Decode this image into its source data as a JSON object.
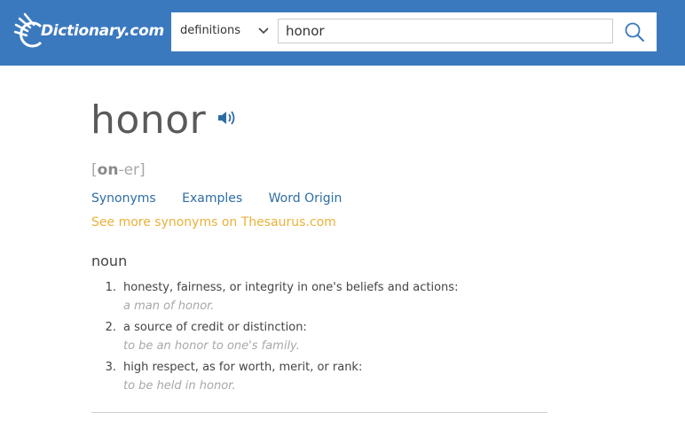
{
  "header": {
    "logo_text": "Dictionary.com",
    "colors": {
      "header_bg": "#3b79bf",
      "link": "#2e6da4",
      "thesaurus": "#e9b13a"
    }
  },
  "search": {
    "scope_selected": "definitions",
    "query": "honor",
    "icons": {
      "scope": "chevron-down-icon",
      "submit": "search-icon"
    }
  },
  "entry": {
    "word": "honor",
    "pronunciation": {
      "open": "[",
      "stressed": "on",
      "rest": "-er",
      "close": "]"
    },
    "links": [
      "Synonyms",
      "Examples",
      "Word Origin"
    ],
    "thesaurus_link": "See more synonyms on Thesaurus.com",
    "part_of_speech": "noun",
    "definitions": [
      {
        "num": "1.",
        "text": "honesty, fairness, or integrity in one's beliefs and actions:",
        "example": "a man of honor."
      },
      {
        "num": "2.",
        "text": "a source of credit or distinction:",
        "example": "to be an honor to one's family."
      },
      {
        "num": "3.",
        "text": "high respect, as for worth, merit, or rank:",
        "example": "to be held in honor."
      }
    ]
  }
}
